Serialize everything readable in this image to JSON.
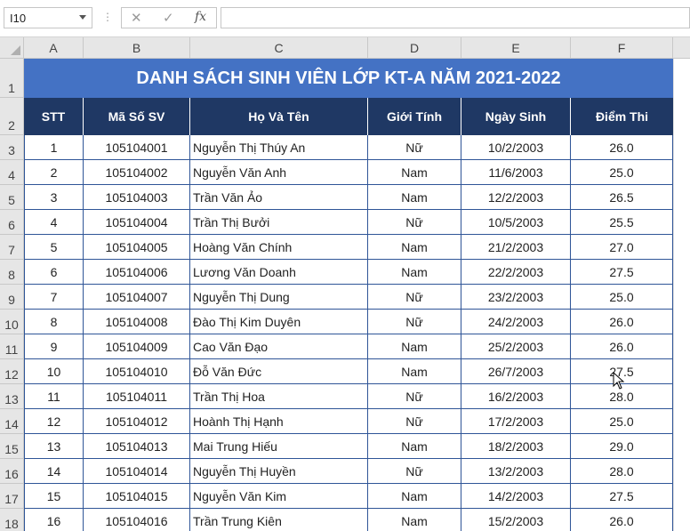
{
  "formula_bar": {
    "name_box": "I10",
    "separator": "⋮",
    "cancel_icon": "✕",
    "enter_icon": "✓",
    "fx_label": "fx",
    "formula": ""
  },
  "columns": [
    "A",
    "B",
    "C",
    "D",
    "E",
    "F"
  ],
  "sheet": {
    "title": "DANH SÁCH SINH VIÊN LỚP KT-A NĂM 2021-2022",
    "headers": [
      "STT",
      "Mã Số SV",
      "Họ Và Tên",
      "Giới Tính",
      "Ngày Sinh",
      "Điểm Thi"
    ],
    "rows": [
      {
        "rn": "3",
        "stt": "1",
        "ma": "105104001",
        "ten": "Nguyễn Thị Thúy An",
        "gt": "Nữ",
        "ns": "10/2/2003",
        "diem": "26.0"
      },
      {
        "rn": "4",
        "stt": "2",
        "ma": "105104002",
        "ten": "Nguyễn Văn Anh",
        "gt": "Nam",
        "ns": "11/6/2003",
        "diem": "25.0"
      },
      {
        "rn": "5",
        "stt": "3",
        "ma": "105104003",
        "ten": "Trần Văn Ảo",
        "gt": "Nam",
        "ns": "12/2/2003",
        "diem": "26.5"
      },
      {
        "rn": "6",
        "stt": "4",
        "ma": "105104004",
        "ten": "Trần Thị Bưởi",
        "gt": "Nữ",
        "ns": "10/5/2003",
        "diem": "25.5"
      },
      {
        "rn": "7",
        "stt": "5",
        "ma": "105104005",
        "ten": "Hoàng Văn Chính",
        "gt": "Nam",
        "ns": "21/2/2003",
        "diem": "27.0"
      },
      {
        "rn": "8",
        "stt": "6",
        "ma": "105104006",
        "ten": "Lương Văn Doanh",
        "gt": "Nam",
        "ns": "22/2/2003",
        "diem": "27.5"
      },
      {
        "rn": "9",
        "stt": "7",
        "ma": "105104007",
        "ten": "Nguyễn Thị Dung",
        "gt": "Nữ",
        "ns": "23/2/2003",
        "diem": "25.0"
      },
      {
        "rn": "10",
        "stt": "8",
        "ma": "105104008",
        "ten": "Đào Thị Kim Duyên",
        "gt": "Nữ",
        "ns": "24/2/2003",
        "diem": "26.0"
      },
      {
        "rn": "11",
        "stt": "9",
        "ma": "105104009",
        "ten": "Cao Văn Đạo",
        "gt": "Nam",
        "ns": "25/2/2003",
        "diem": "26.0"
      },
      {
        "rn": "12",
        "stt": "10",
        "ma": "105104010",
        "ten": "Đỗ Văn Đức",
        "gt": "Nam",
        "ns": "26/7/2003",
        "diem": "27.5"
      },
      {
        "rn": "13",
        "stt": "11",
        "ma": "105104011",
        "ten": "Trần Thị Hoa",
        "gt": "Nữ",
        "ns": "16/2/2003",
        "diem": "28.0"
      },
      {
        "rn": "14",
        "stt": "12",
        "ma": "105104012",
        "ten": "Hoành Thị Hạnh",
        "gt": "Nữ",
        "ns": "17/2/2003",
        "diem": "25.0"
      },
      {
        "rn": "15",
        "stt": "13",
        "ma": "105104013",
        "ten": "Mai Trung Hiếu",
        "gt": "Nam",
        "ns": "18/2/2003",
        "diem": "29.0"
      },
      {
        "rn": "16",
        "stt": "14",
        "ma": "105104014",
        "ten": "Nguyễn Thị Huyền",
        "gt": "Nữ",
        "ns": "13/2/2003",
        "diem": "28.0"
      },
      {
        "rn": "17",
        "stt": "15",
        "ma": "105104015",
        "ten": "Nguyễn Văn Kim",
        "gt": "Nam",
        "ns": "14/2/2003",
        "diem": "27.5"
      },
      {
        "rn": "18",
        "stt": "16",
        "ma": "105104016",
        "ten": "Trần Trung Kiên",
        "gt": "Nam",
        "ns": "15/2/2003",
        "diem": "26.0"
      }
    ]
  },
  "row_numbers_top": [
    "1",
    "2"
  ],
  "colors": {
    "title_bg": "#4472c4",
    "header_bg": "#1f3864",
    "border": "#2f5597"
  }
}
